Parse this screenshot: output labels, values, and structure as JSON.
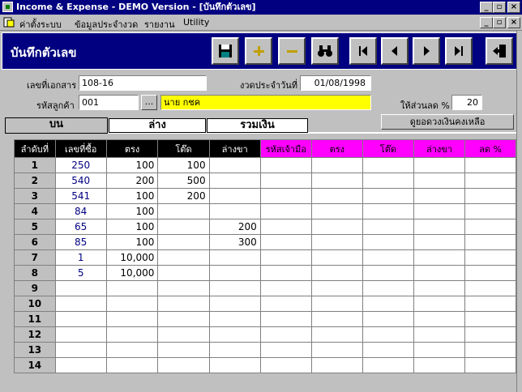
{
  "window": {
    "title": "Income & Expense - DEMO Version - [บันทึกตัวเลข]"
  },
  "menu": {
    "items": [
      "ค่าตั้งระบบ",
      "ข้อมูลประจำงวด",
      "รายงาน",
      "Utility"
    ]
  },
  "header": {
    "title": "บันทึกตัวเลข",
    "toolbar": [
      "save-icon",
      "add-icon",
      "remove-icon",
      "find-icon",
      "first-icon",
      "prev-icon",
      "next-icon",
      "last-icon",
      "exit-icon"
    ]
  },
  "form": {
    "doc_no_label": "เลขที่เอกสาร",
    "doc_no": "108-16",
    "period_label": "งวดประจำวันที่",
    "period": "01/08/1998",
    "customer_label": "รหัสลูกค้า",
    "customer_code": "001",
    "browse_label": "...",
    "customer_name": "นาย กชค",
    "discount_label": "ให้ส่วนลด %",
    "discount": "20",
    "balance_button": "ดูยอดวงเงินคงเหลือ"
  },
  "tabs": [
    "บน",
    "ล่าง",
    "รวมเงิน"
  ],
  "grid": {
    "columns": [
      "ลำดับที่",
      "เลขที่ซื้อ",
      "ตรง",
      "โต๊ด",
      "ล่างขา",
      "รหัสเจ้ามือ",
      "ตรง",
      "โต๊ด",
      "ล่างขา",
      "ลด %"
    ],
    "rows": [
      {
        "n": "1",
        "num": "250",
        "straight": "100",
        "tod": "100",
        "lower": ""
      },
      {
        "n": "2",
        "num": "540",
        "straight": "200",
        "tod": "500",
        "lower": ""
      },
      {
        "n": "3",
        "num": "541",
        "straight": "100",
        "tod": "200",
        "lower": ""
      },
      {
        "n": "4",
        "num": "84",
        "straight": "100",
        "tod": "",
        "lower": ""
      },
      {
        "n": "5",
        "num": "65",
        "straight": "100",
        "tod": "",
        "lower": "200"
      },
      {
        "n": "6",
        "num": "85",
        "straight": "100",
        "tod": "",
        "lower": "300"
      },
      {
        "n": "7",
        "num": "1",
        "straight": "10,000",
        "tod": "",
        "lower": ""
      },
      {
        "n": "8",
        "num": "5",
        "straight": "10,000",
        "tod": "",
        "lower": ""
      },
      {
        "n": "9",
        "num": "",
        "straight": "",
        "tod": "",
        "lower": ""
      },
      {
        "n": "10",
        "num": "",
        "straight": "",
        "tod": "",
        "lower": ""
      },
      {
        "n": "11",
        "num": "",
        "straight": "",
        "tod": "",
        "lower": ""
      },
      {
        "n": "12",
        "num": "",
        "straight": "",
        "tod": "",
        "lower": ""
      },
      {
        "n": "13",
        "num": "",
        "straight": "",
        "tod": "",
        "lower": ""
      },
      {
        "n": "14",
        "num": "",
        "straight": "",
        "tod": "",
        "lower": ""
      }
    ]
  }
}
